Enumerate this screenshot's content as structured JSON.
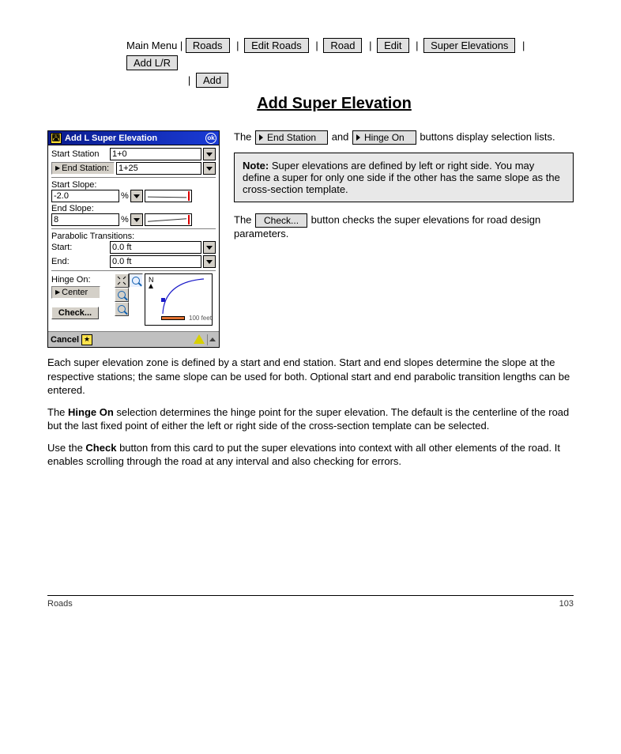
{
  "breadcrumb": {
    "prefix": "Main Menu |",
    "items": [
      "Roads",
      "Edit Roads",
      "Road",
      "|",
      "Edit",
      "Super Elevations",
      "Add L/R",
      "Add"
    ]
  },
  "title": "Add Super Elevation",
  "dialog": {
    "title": "Add L Super Elevation",
    "ok": "ok",
    "start_station_label": "Start Station",
    "start_station_value": "1+0",
    "end_station_btn": "End Station:",
    "end_station_value": "1+25",
    "start_slope_label": "Start Slope:",
    "start_slope_value": "-2.0",
    "pct1": "%",
    "end_slope_label": "End Slope:",
    "end_slope_value": "8",
    "pct2": "%",
    "parabolic_label": "Parabolic Transitions:",
    "pt_start_label": "Start:",
    "pt_start_value": "0.0 ft",
    "pt_end_label": "End:",
    "pt_end_value": "0.0 ft",
    "hinge_label": "Hinge On:",
    "hinge_btn": "Center",
    "check_btn": "Check...",
    "map_north": "N",
    "map_scale": "100 feet",
    "footer_cancel": "Cancel",
    "footer_star": "★"
  },
  "right": {
    "para1_a": "The ",
    "para1_btn1": "End Station",
    "para1_b": " and ",
    "para1_btn2": "Hinge On",
    "para1_c": " buttons display selection lists.",
    "note_label": "Note:",
    "note_text": " Super elevations are defined by left or right side. You may define a super for only one side if the other has the same slope as the cross-section template.",
    "check_a": "The ",
    "check_btn": "Check...",
    "check_b": " button checks the super elevations for road design parameters."
  },
  "body": {
    "p1": "Each super elevation zone is defined by a start and end station. Start and end slopes determine the slope at the respective stations; the same slope can be used for both. Optional start and end parabolic transition lengths can be entered.",
    "p2a": "The ",
    "p2_bold": "Hinge On",
    "p2b": " selection determines the hinge point for the super elevation. The default is the centerline of the road but the last fixed point of either the left or right side of the cross-section template can be selected.",
    "p3a": "Use the ",
    "p3_bold": "Check",
    "p3b": " button from this card to put the super elevations into context with all other elements of the road. It enables scrolling through the road at any interval and also checking for errors."
  },
  "footer": {
    "left": "Roads",
    "right": "103"
  }
}
